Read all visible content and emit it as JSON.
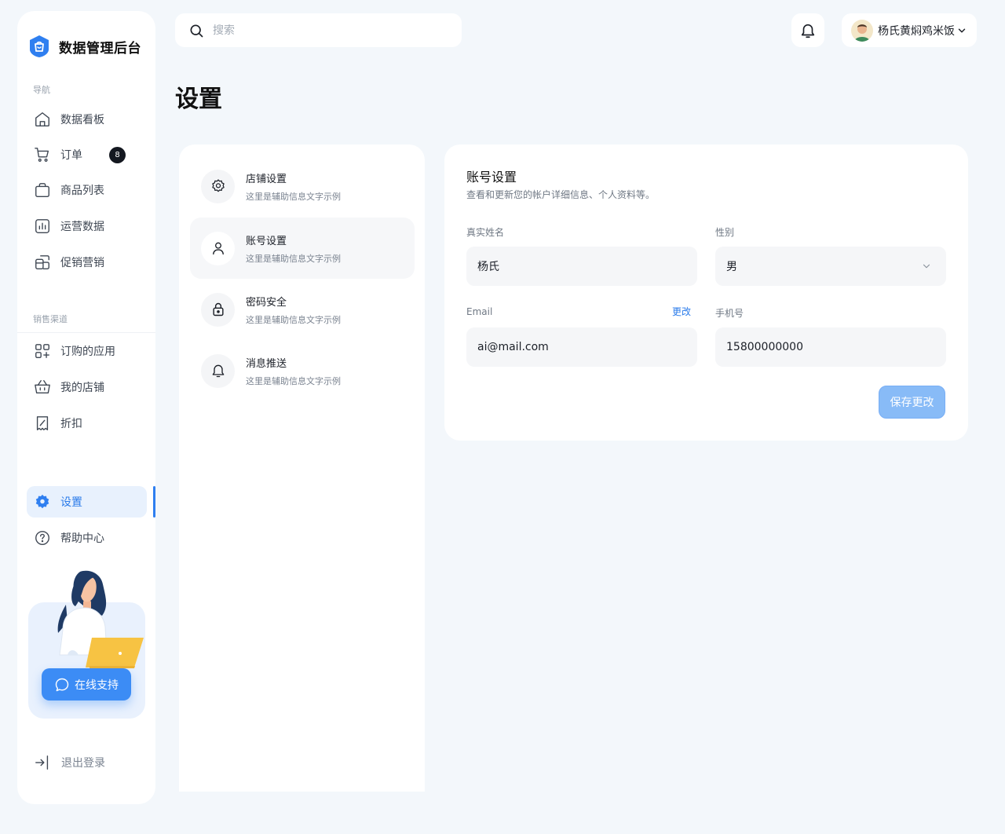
{
  "colors": {
    "accent": "#2f7ff0",
    "page_bg": "#f3f7fb",
    "badge_bg": "#141820"
  },
  "brand": {
    "name": "数据管理后台",
    "icon": "shield-bag-icon"
  },
  "sidebar": {
    "nav_label": "导航",
    "nav_items": [
      {
        "label": "数据看板",
        "icon": "home-icon"
      },
      {
        "label": "订单",
        "icon": "cart-icon",
        "badge": "8"
      },
      {
        "label": "商品列表",
        "icon": "bag-icon"
      },
      {
        "label": "运营数据",
        "icon": "chart-icon"
      },
      {
        "label": "促销营销",
        "icon": "promo-icon"
      }
    ],
    "channel_label": "销售渠道",
    "channel_items": [
      {
        "label": "订购的应用",
        "icon": "apps-icon"
      },
      {
        "label": "我的店铺",
        "icon": "basket-icon"
      },
      {
        "label": "折扣",
        "icon": "discount-icon"
      }
    ],
    "bottom_items": [
      {
        "label": "设置",
        "icon": "gear-icon",
        "active": true
      },
      {
        "label": "帮助中心",
        "icon": "help-icon"
      }
    ],
    "support_button": "在线支持",
    "logout": "退出登录"
  },
  "search": {
    "placeholder": "搜索"
  },
  "user": {
    "name": "杨氏黄焖鸡米饭"
  },
  "page": {
    "title": "设置"
  },
  "settings_menu": [
    {
      "title": "店铺设置",
      "subtitle": "这里是辅助信息文字示例",
      "icon": "gear-icon"
    },
    {
      "title": "账号设置",
      "subtitle": "这里是辅助信息文字示例",
      "icon": "user-icon",
      "active": true
    },
    {
      "title": "密码安全",
      "subtitle": "这里是辅助信息文字示例",
      "icon": "lock-icon"
    },
    {
      "title": "消息推送",
      "subtitle": "这里是辅助信息文字示例",
      "icon": "bell-icon"
    }
  ],
  "account_form": {
    "title": "账号设置",
    "description": "查看和更新您的帐户详细信息、个人资料等。",
    "real_name_label": "真实姓名",
    "real_name_value": "杨氏",
    "gender_label": "性别",
    "gender_value": "男",
    "email_label": "Email",
    "email_change": "更改",
    "email_value": "ai@mail.com",
    "phone_label": "手机号",
    "phone_value": "15800000000",
    "save_label": "保存更改"
  }
}
